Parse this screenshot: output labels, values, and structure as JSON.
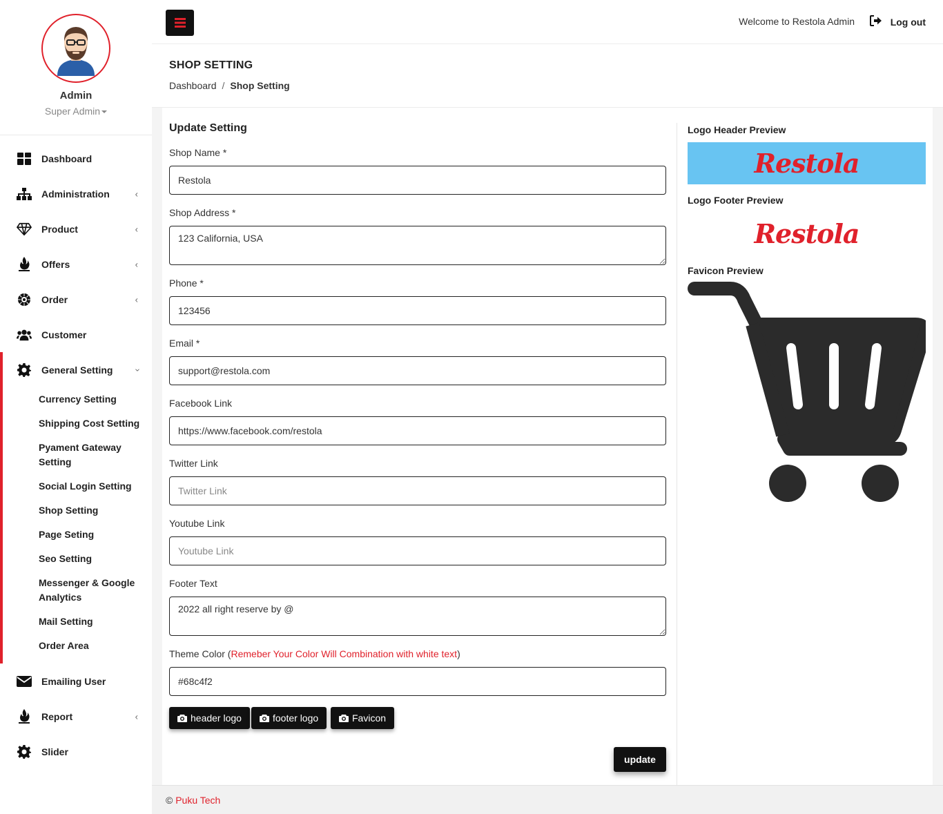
{
  "profile": {
    "name": "Admin",
    "role": "Super Admin"
  },
  "sidebar": {
    "items": [
      {
        "label": "Dashboard",
        "icon": "dashboard-icon",
        "has_arrow": false
      },
      {
        "label": "Administration",
        "icon": "sitemap-icon",
        "has_arrow": true
      },
      {
        "label": "Product",
        "icon": "diamond-icon",
        "has_arrow": true
      },
      {
        "label": "Offers",
        "icon": "fire-icon",
        "has_arrow": true
      },
      {
        "label": "Order",
        "icon": "order-icon",
        "has_arrow": true
      },
      {
        "label": "Customer",
        "icon": "users-icon",
        "has_arrow": false
      }
    ],
    "general_setting": {
      "label": "General Setting",
      "icon": "gear-icon",
      "submenu": [
        "Currency Setting",
        "Shipping Cost Setting",
        "Pyament Gateway Setting",
        "Social Login Setting",
        "Shop Setting",
        "Page Seting",
        "Seo Setting",
        "Messenger & Google Analytics",
        "Mail Setting",
        "Order Area"
      ]
    },
    "bottom_items": [
      {
        "label": "Emailing User",
        "icon": "envelope-icon",
        "has_arrow": false
      },
      {
        "label": "Report",
        "icon": "fire-icon",
        "has_arrow": true
      },
      {
        "label": "Slider",
        "icon": "gear-icon",
        "has_arrow": false
      }
    ]
  },
  "topbar": {
    "welcome": "Welcome to Restola Admin",
    "logout": "Log out"
  },
  "page": {
    "title": "SHOP SETTING",
    "breadcrumb": {
      "home": "Dashboard",
      "separator": "/",
      "current": "Shop Setting"
    }
  },
  "form": {
    "title": "Update Setting",
    "shop_name": {
      "label": "Shop Name *",
      "value": "Restola"
    },
    "shop_address": {
      "label": "Shop Address *",
      "value": "123 California, USA"
    },
    "phone": {
      "label": "Phone *",
      "value": "123456"
    },
    "email": {
      "label": "Email *",
      "value": "support@restola.com"
    },
    "facebook": {
      "label": "Facebook Link",
      "value": "https://www.facebook.com/restola"
    },
    "twitter": {
      "label": "Twitter Link",
      "value": "",
      "placeholder": "Twitter Link"
    },
    "youtube": {
      "label": "Youtube Link",
      "value": "",
      "placeholder": "Youtube Link"
    },
    "footer_text": {
      "label": "Footer Text",
      "value": "2022 all right reserve by @"
    },
    "theme_color": {
      "label": "Theme Color (",
      "hint": "Remeber Your Color Will Combination with white text",
      "label_end": ")",
      "value": "#68c4f2"
    },
    "buttons": {
      "header_logo": "header logo",
      "footer_logo": "footer logo",
      "favicon": "Favicon",
      "update": "update"
    }
  },
  "preview": {
    "header_label": "Logo Header Preview",
    "footer_label": "Logo Footer Preview",
    "favicon_label": "Favicon Preview",
    "logo_text": "Restola",
    "header_bg": "#68c4f2"
  },
  "footer": {
    "copyright": "©",
    "brand": "Puku Tech"
  },
  "colors": {
    "accent": "#e0212b",
    "dark": "#111111",
    "theme": "#68c4f2"
  }
}
